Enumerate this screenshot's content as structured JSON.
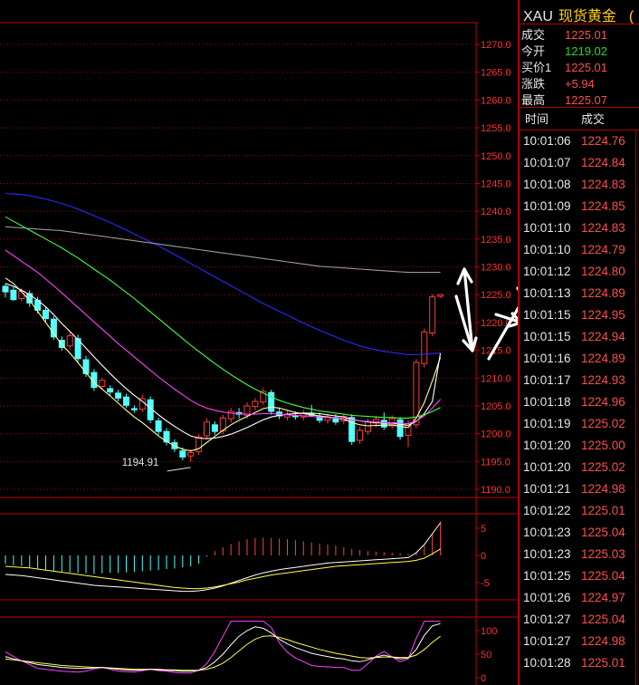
{
  "header": {
    "code": "XAU",
    "name": "现货黄金",
    "extra": "("
  },
  "quote": [
    {
      "label": "成交",
      "value": "1225.01",
      "color": "#ff4d4d"
    },
    {
      "label": "今开",
      "value": "1219.02",
      "color": "#22dd22"
    },
    {
      "label": "买价1",
      "value": "1225.01",
      "color": "#ff4d4d"
    },
    {
      "label": "涨跌",
      "value": "+5.94",
      "color": "#ff4d4d"
    },
    {
      "label": "最高",
      "value": "1225.07",
      "color": "#ff4d4d"
    }
  ],
  "ticks_header": {
    "time": "时间",
    "price": "成交"
  },
  "ticks": [
    {
      "time": "10:01:06",
      "price": "1224.76"
    },
    {
      "time": "10:01:07",
      "price": "1224.84"
    },
    {
      "time": "10:01:08",
      "price": "1224.83"
    },
    {
      "time": "10:01:09",
      "price": "1224.85"
    },
    {
      "time": "10:01:10",
      "price": "1224.83"
    },
    {
      "time": "10:01:10",
      "price": "1224.79"
    },
    {
      "time": "10:01:12",
      "price": "1224.80"
    },
    {
      "time": "10:01:13",
      "price": "1224.89"
    },
    {
      "time": "10:01:15",
      "price": "1224.95"
    },
    {
      "time": "10:01:15",
      "price": "1224.94"
    },
    {
      "time": "10:01:16",
      "price": "1224.89"
    },
    {
      "time": "10:01:17",
      "price": "1224.93"
    },
    {
      "time": "10:01:18",
      "price": "1224.96"
    },
    {
      "time": "10:01:19",
      "price": "1225.02"
    },
    {
      "time": "10:01:20",
      "price": "1225.00"
    },
    {
      "time": "10:01:20",
      "price": "1225.02"
    },
    {
      "time": "10:01:21",
      "price": "1224.98"
    },
    {
      "time": "10:01:22",
      "price": "1225.01"
    },
    {
      "time": "10:01:23",
      "price": "1225.04"
    },
    {
      "time": "10:01:23",
      "price": "1225.03"
    },
    {
      "time": "10:01:25",
      "price": "1225.04"
    },
    {
      "time": "10:01:26",
      "price": "1224.97"
    },
    {
      "time": "10:01:27",
      "price": "1225.04"
    },
    {
      "time": "10:01:27",
      "price": "1224.98"
    },
    {
      "time": "10:01:28",
      "price": "1225.01"
    }
  ],
  "chart_data": {
    "type": "candlestick",
    "title": "",
    "yaxis": [
      1270.0,
      1265.0,
      1260.0,
      1255.0,
      1250.0,
      1245.0,
      1240.0,
      1235.0,
      1230.0,
      1225.0,
      1220.0,
      1215.0,
      1210.0,
      1205.0,
      1200.0,
      1195.0,
      1190.0
    ],
    "ylim": [
      1188.5,
      1271.5
    ],
    "ytick_labels": [
      "1270.0",
      "1265.0",
      "1260.0",
      "1255.0",
      "1250.0",
      "1245.0",
      "1240.0",
      "1235.0",
      "1230.0",
      "1225.0",
      "1220.0",
      "1215.0",
      "1210.0",
      "1205.0",
      "1200.0",
      "1195.0",
      "1190.0"
    ],
    "low_annotation": {
      "label": "1194.91",
      "value": 1194.91
    },
    "candles": [
      [
        1226.5,
        1227,
        1224.5,
        1225.5
      ],
      [
        1225.8,
        1226.4,
        1223.9,
        1224.1
      ],
      [
        1224.3,
        1226.2,
        1223.8,
        1225.6
      ],
      [
        1225.2,
        1225.8,
        1222.8,
        1223.5
      ],
      [
        1224.0,
        1224.6,
        1221.6,
        1222.2
      ],
      [
        1222.2,
        1222.8,
        1220.1,
        1220.7
      ],
      [
        1220.6,
        1221.1,
        1216.9,
        1217.4
      ],
      [
        1216.8,
        1217.5,
        1214.9,
        1215.5
      ],
      [
        1215.8,
        1218.2,
        1215.3,
        1217.6
      ],
      [
        1217.1,
        1217.8,
        1212.9,
        1213.5
      ],
      [
        1213.3,
        1214.0,
        1210.2,
        1210.8
      ],
      [
        1211.0,
        1211.6,
        1207.7,
        1208.3
      ],
      [
        1208.5,
        1210.1,
        1207.9,
        1209.6
      ],
      [
        1208.1,
        1208.7,
        1206.9,
        1207.5
      ],
      [
        1207.3,
        1207.9,
        1205.8,
        1206.4
      ],
      [
        1206.6,
        1207.2,
        1204.6,
        1205.1
      ],
      [
        1204.5,
        1205.1,
        1203.8,
        1204.3
      ],
      [
        1204.4,
        1206.9,
        1203.9,
        1206.3
      ],
      [
        1206.1,
        1206.7,
        1201.9,
        1202.5
      ],
      [
        1202.3,
        1202.9,
        1199.8,
        1200.4
      ],
      [
        1200.4,
        1201.0,
        1197.9,
        1198.5
      ],
      [
        1198.4,
        1199.0,
        1196.7,
        1197.3
      ],
      [
        1196.9,
        1197.5,
        1195.2,
        1195.8
      ],
      [
        1196.0,
        1197.2,
        1194.91,
        1196.6
      ],
      [
        1196.8,
        1199.9,
        1196.2,
        1199.4
      ],
      [
        1199.6,
        1202.8,
        1199.0,
        1202.1
      ],
      [
        1201.6,
        1202.2,
        1199.8,
        1200.4
      ],
      [
        1200.5,
        1203.4,
        1199.9,
        1202.8
      ],
      [
        1202.7,
        1204.6,
        1202.0,
        1204.0
      ],
      [
        1203.8,
        1204.6,
        1202.7,
        1203.5
      ],
      [
        1203.3,
        1205.6,
        1202.7,
        1205.0
      ],
      [
        1204.9,
        1206.4,
        1204.2,
        1205.8
      ],
      [
        1205.7,
        1208.2,
        1205.2,
        1207.6
      ],
      [
        1207.4,
        1207.9,
        1203.4,
        1204.0
      ],
      [
        1203.9,
        1204.7,
        1202.6,
        1203.2
      ],
      [
        1203.0,
        1204.1,
        1202.4,
        1203.5
      ],
      [
        1203.2,
        1204.0,
        1202.5,
        1203.1
      ],
      [
        1203.0,
        1204.3,
        1202.4,
        1203.7
      ],
      [
        1203.6,
        1205.2,
        1203.0,
        1203.3
      ],
      [
        1203.1,
        1203.8,
        1201.9,
        1202.4
      ],
      [
        1202.4,
        1203.5,
        1201.8,
        1203.0
      ],
      [
        1202.9,
        1203.5,
        1201.6,
        1202.1
      ],
      [
        1202.3,
        1203.6,
        1201.7,
        1203.1
      ],
      [
        1202.9,
        1203.5,
        1198.0,
        1198.6
      ],
      [
        1198.8,
        1201.2,
        1198.2,
        1200.6
      ],
      [
        1200.4,
        1202.7,
        1199.8,
        1202.1
      ],
      [
        1201.9,
        1203.2,
        1201.1,
        1202.6
      ],
      [
        1202.4,
        1203.8,
        1200.7,
        1201.2
      ],
      [
        1201.4,
        1203.3,
        1200.9,
        1202.7
      ],
      [
        1202.5,
        1203.0,
        1198.9,
        1199.5
      ],
      [
        1199.7,
        1202.4,
        1197.6,
        1201.8
      ],
      [
        1201.6,
        1213.4,
        1201.0,
        1212.8
      ],
      [
        1212.6,
        1218.9,
        1211.9,
        1218.3
      ],
      [
        1218.1,
        1225.1,
        1217.5,
        1224.6
      ],
      [
        1224.7,
        1225.07,
        1224.4,
        1225.01
      ]
    ],
    "moving_averages": [
      {
        "color": "#ffffa0",
        "values": [
          1228,
          1227,
          1225.5,
          1224,
          1222,
          1220,
          1218,
          1216,
          1214.5,
          1212.8,
          1211,
          1209.2,
          1208,
          1206.8,
          1205.5,
          1204.2,
          1203,
          1202,
          1200.8,
          1199.6,
          1198.6,
          1197.8,
          1197.2,
          1196.9,
          1197.3,
          1198.4,
          1199.5,
          1200.6,
          1201.6,
          1202.4,
          1203.1,
          1203.8,
          1204.5,
          1204.8,
          1204.6,
          1204.2,
          1203.8,
          1203.6,
          1203.4,
          1203.2,
          1203.0,
          1202.8,
          1202.6,
          1202.0,
          1201.6,
          1201.4,
          1201.5,
          1201.5,
          1201.6,
          1201.3,
          1201.1,
          1202.8,
          1205.6,
          1209.5,
          1213.7
        ]
      },
      {
        "color": "#ffffff",
        "values": [
          1227,
          1226.5,
          1225.8,
          1225,
          1224,
          1222.8,
          1221.4,
          1219.8,
          1218.4,
          1216.9,
          1215.4,
          1213.8,
          1212.3,
          1210.8,
          1209.4,
          1208.1,
          1206.9,
          1205.8,
          1204.6,
          1203.4,
          1202.3,
          1201.3,
          1200.4,
          1199.6,
          1199.2,
          1199.1,
          1199.2,
          1199.5,
          1199.9,
          1200.5,
          1201.1,
          1201.8,
          1202.5,
          1203.0,
          1203.3,
          1203.5,
          1203.6,
          1203.7,
          1203.7,
          1203.6,
          1203.4,
          1203.2,
          1203.0,
          1202.6,
          1202.3,
          1202.1,
          1202.0,
          1201.9,
          1201.9,
          1201.7,
          1201.5,
          1202.2,
          1203.6,
          1205.8,
          1214.5
        ]
      },
      {
        "color": "#ff40ff",
        "values": [
          1233,
          1232,
          1231,
          1230,
          1229,
          1227.8,
          1226.6,
          1225.3,
          1224,
          1222.7,
          1221.4,
          1220.1,
          1218.8,
          1217.5,
          1216.2,
          1215,
          1213.8,
          1212.6,
          1211.4,
          1210.2,
          1209.1,
          1208,
          1207,
          1206,
          1205.2,
          1204.6,
          1204.2,
          1203.9,
          1203.7,
          1203.6,
          1203.5,
          1203.5,
          1203.6,
          1203.6,
          1203.5,
          1203.4,
          1203.3,
          1203.2,
          1203.1,
          1203.0,
          1202.9,
          1202.8,
          1202.7,
          1202.5,
          1202.3,
          1202.2,
          1202.1,
          1202.0,
          1202.0,
          1201.9,
          1201.8,
          1202.3,
          1203.2,
          1204.6,
          1206.2
        ]
      },
      {
        "color": "#40ff40",
        "values": [
          1239,
          1238.2,
          1237.4,
          1236.6,
          1235.8,
          1235,
          1234.2,
          1233.4,
          1232.5,
          1231.6,
          1230.6,
          1229.6,
          1228.6,
          1227.6,
          1226.5,
          1225.4,
          1224.3,
          1223.1,
          1221.9,
          1220.7,
          1219.5,
          1218.3,
          1217.1,
          1215.9,
          1214.8,
          1213.7,
          1212.6,
          1211.6,
          1210.6,
          1209.7,
          1208.8,
          1208.0,
          1207.3,
          1206.6,
          1206.0,
          1205.5,
          1205.1,
          1204.7,
          1204.4,
          1204.1,
          1203.9,
          1203.7,
          1203.5,
          1203.3,
          1203.2,
          1203.1,
          1203.0,
          1202.9,
          1202.9,
          1202.8,
          1202.8,
          1203.0,
          1203.4,
          1204.0,
          1204.7
        ]
      },
      {
        "color": "#2a2aff",
        "values": [
          1243.2,
          1243.1,
          1243.0,
          1242.8,
          1242.5,
          1242.2,
          1241.8,
          1241.4,
          1240.9,
          1240.4,
          1239.8,
          1239.2,
          1238.6,
          1238.0,
          1237.3,
          1236.6,
          1235.9,
          1235.2,
          1234.5,
          1233.8,
          1233.0,
          1232.2,
          1231.4,
          1230.6,
          1229.8,
          1229.0,
          1228.2,
          1227.4,
          1226.6,
          1225.8,
          1225.0,
          1224.2,
          1223.4,
          1222.7,
          1222.0,
          1221.3,
          1220.6,
          1219.9,
          1219.2,
          1218.6,
          1218.0,
          1217.4,
          1216.8,
          1216.3,
          1215.8,
          1215.4,
          1215.1,
          1214.8,
          1214.6,
          1214.4,
          1214.2,
          1214.2,
          1214.3,
          1214.4,
          1214.5
        ]
      },
      {
        "color": "#9a9a9a",
        "values": [
          1237.2,
          1237.1,
          1237,
          1236.9,
          1236.8,
          1236.7,
          1236.6,
          1236.5,
          1236.3,
          1236.1,
          1235.9,
          1235.7,
          1235.5,
          1235.3,
          1235.1,
          1234.9,
          1234.7,
          1234.5,
          1234.3,
          1234.1,
          1233.9,
          1233.7,
          1233.5,
          1233.3,
          1233.1,
          1232.9,
          1232.7,
          1232.5,
          1232.3,
          1232.1,
          1231.9,
          1231.7,
          1231.5,
          1231.3,
          1231.1,
          1230.9,
          1230.7,
          1230.5,
          1230.3,
          1230.1,
          1230.0,
          1229.9,
          1229.8,
          1229.7,
          1229.6,
          1229.5,
          1229.4,
          1229.3,
          1229.2,
          1229.1,
          1229.0,
          1229.0,
          1229.0,
          1229.0,
          1229.0
        ]
      }
    ],
    "macd": {
      "ytick_labels": [
        "5",
        "0",
        "-5"
      ],
      "ylim": [
        -8,
        8
      ],
      "histogram": [
        -1.5,
        -1.8,
        -1.9,
        -2.2,
        -2.4,
        -2.6,
        -2.8,
        -3.0,
        -3.1,
        -3.2,
        -3.3,
        -3.4,
        -3.3,
        -3.2,
        -3.2,
        -3.1,
        -3.0,
        -2.9,
        -2.8,
        -2.7,
        -2.5,
        -2.4,
        -2.2,
        -2.0,
        -1.5,
        -0.2,
        0.8,
        1.5,
        2.1,
        2.6,
        3.0,
        3.2,
        3.3,
        3.2,
        3.1,
        3.0,
        2.8,
        2.6,
        2.4,
        2.2,
        2.0,
        1.8,
        1.5,
        1.2,
        1.0,
        0.8,
        0.7,
        0.6,
        0.5,
        0.4,
        0.3,
        0.6,
        1.8,
        4.0,
        6.3
      ],
      "dif": [
        -3.5,
        -3.6,
        -3.7,
        -3.9,
        -4.1,
        -4.3,
        -4.5,
        -4.7,
        -4.9,
        -5.1,
        -5.3,
        -5.5,
        -5.6,
        -5.7,
        -5.8,
        -5.9,
        -6.0,
        -6.1,
        -6.2,
        -6.3,
        -6.4,
        -6.5,
        -6.6,
        -6.6,
        -6.5,
        -6.3,
        -6.0,
        -5.6,
        -5.1,
        -4.6,
        -4.1,
        -3.6,
        -3.2,
        -2.9,
        -2.6,
        -2.4,
        -2.2,
        -2.0,
        -1.8,
        -1.6,
        -1.4,
        -1.3,
        -1.2,
        -1.1,
        -1.0,
        -0.9,
        -0.8,
        -0.7,
        -0.6,
        -0.5,
        -0.4,
        0.5,
        2.0,
        4.0,
        6.0
      ],
      "dea": [
        -2.0,
        -2.1,
        -2.2,
        -2.3,
        -2.5,
        -2.7,
        -2.9,
        -3.1,
        -3.3,
        -3.5,
        -3.7,
        -3.9,
        -4.1,
        -4.3,
        -4.5,
        -4.7,
        -4.9,
        -5.1,
        -5.3,
        -5.5,
        -5.7,
        -5.9,
        -6.0,
        -6.1,
        -6.1,
        -6.0,
        -5.8,
        -5.5,
        -5.2,
        -4.9,
        -4.5,
        -4.2,
        -3.9,
        -3.6,
        -3.4,
        -3.2,
        -3.0,
        -2.8,
        -2.6,
        -2.4,
        -2.2,
        -2.0,
        -1.9,
        -1.8,
        -1.7,
        -1.6,
        -1.5,
        -1.4,
        -1.3,
        -1.2,
        -1.1,
        -0.9,
        -0.5,
        0.3,
        1.2
      ]
    },
    "kdj": {
      "ytick_labels": [
        "100",
        "50",
        "0"
      ],
      "ylim": [
        0,
        120
      ],
      "k": [
        45,
        40,
        36,
        32,
        28,
        26,
        24,
        22,
        21,
        20,
        20,
        21,
        22,
        20,
        18,
        17,
        16,
        17,
        18,
        17,
        16,
        15,
        14,
        14,
        16,
        22,
        34,
        50,
        70,
        88,
        100,
        108,
        105,
        95,
        82,
        72,
        64,
        58,
        52,
        48,
        45,
        42,
        40,
        36,
        34,
        38,
        44,
        48,
        44,
        40,
        42,
        60,
        90,
        110,
        115
      ],
      "d": [
        40,
        38,
        36,
        34,
        32,
        30,
        28,
        26,
        25,
        24,
        23,
        22,
        22,
        21,
        20,
        19,
        18,
        18,
        18,
        18,
        17,
        17,
        16,
        16,
        16,
        18,
        23,
        31,
        43,
        57,
        71,
        82,
        88,
        89,
        86,
        81,
        75,
        70,
        65,
        60,
        56,
        52,
        49,
        46,
        43,
        42,
        43,
        44,
        44,
        43,
        43,
        48,
        60,
        75,
        88
      ],
      "j": [
        55,
        45,
        36,
        28,
        20,
        18,
        16,
        14,
        13,
        12,
        14,
        19,
        22,
        18,
        14,
        13,
        12,
        15,
        18,
        15,
        14,
        11,
        10,
        10,
        16,
        30,
        56,
        88,
        124,
        150,
        158,
        160,
        139,
        107,
        74,
        54,
        42,
        34,
        26,
        24,
        23,
        22,
        22,
        16,
        16,
        30,
        46,
        56,
        44,
        34,
        40,
        84,
        150,
        180,
        169
      ]
    }
  }
}
